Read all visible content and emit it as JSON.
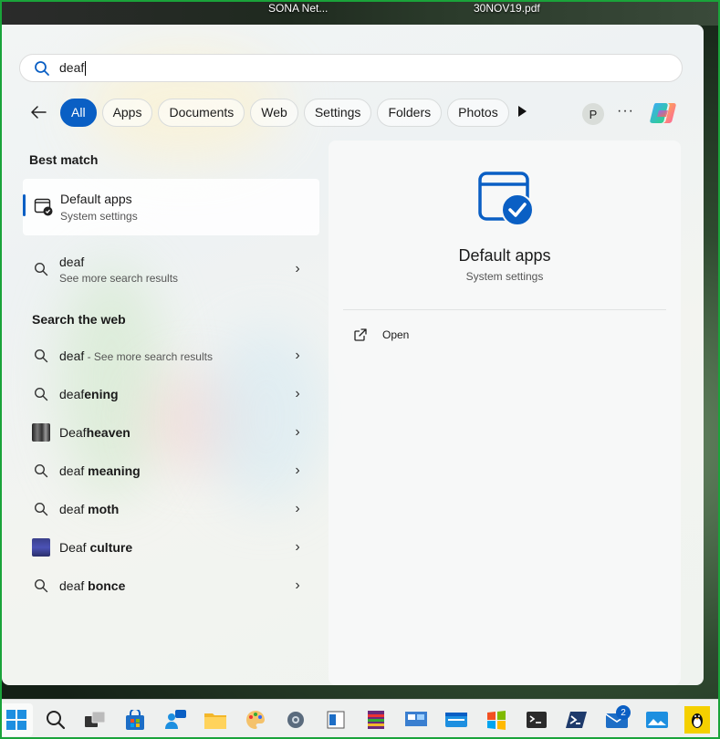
{
  "desktop": {
    "label_left": "SONA Net...",
    "label_right": "30NOV19.pdf"
  },
  "search": {
    "value": "deaf"
  },
  "filters": {
    "items": [
      {
        "label": "All",
        "active": true
      },
      {
        "label": "Apps"
      },
      {
        "label": "Documents"
      },
      {
        "label": "Web"
      },
      {
        "label": "Settings"
      },
      {
        "label": "Folders"
      },
      {
        "label": "Photos"
      }
    ],
    "avatar_initial": "P",
    "more_label": "···"
  },
  "best_match": {
    "heading": "Best match",
    "title": "Default apps",
    "subtitle": "System settings"
  },
  "local_result": {
    "title": "deaf",
    "subtitle": "See more search results"
  },
  "web": {
    "heading": "Search the web",
    "items": [
      {
        "prefix": "deaf",
        "rest": "",
        "suffix": " - See more search results",
        "icon": "search-icon"
      },
      {
        "prefix": "deaf",
        "rest": "ening",
        "suffix": "",
        "icon": "search-icon"
      },
      {
        "prefix": "Deaf",
        "rest": "heaven",
        "suffix": "",
        "icon": "band-thumbnail"
      },
      {
        "prefix": "deaf",
        "rest": " meaning",
        "suffix": "",
        "icon": "search-icon"
      },
      {
        "prefix": "deaf",
        "rest": " moth",
        "suffix": "",
        "icon": "search-icon"
      },
      {
        "prefix": "Deaf",
        "rest": " culture",
        "suffix": "",
        "icon": "person-thumbnail"
      },
      {
        "prefix": "deaf",
        "rest": " bonce",
        "suffix": "",
        "icon": "search-icon"
      }
    ]
  },
  "preview": {
    "title": "Default apps",
    "subtitle": "System settings",
    "action_label": "Open"
  },
  "taskbar": {
    "mail_badge": "2",
    "icons": [
      "windows-start-icon",
      "search-icon",
      "task-view-icon",
      "store-icon",
      "people-icon",
      "file-explorer-icon",
      "paint-icon",
      "settings-gear-icon",
      "notepad-icon",
      "winrar-icon",
      "control-panel-icon",
      "app-window-icon",
      "windows-logo-app-icon",
      "terminal-icon",
      "powershell-icon",
      "mail-icon",
      "photos-icon",
      "linux-penguin-icon"
    ]
  },
  "colors": {
    "accent": "#0a5fc4",
    "panel_bg": "#f2f5f4"
  }
}
